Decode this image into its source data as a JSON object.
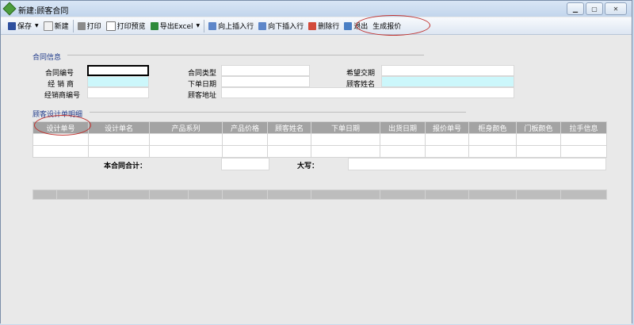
{
  "window": {
    "title": "新建:顾客合同"
  },
  "toolbar": {
    "save": "保存",
    "new": "新建",
    "print": "打印",
    "print_preview": "打印预览",
    "export_excel": "导出Excel",
    "insert_above": "向上插入行",
    "insert_below": "向下插入行",
    "delete_row": "删除行",
    "exit": "退出",
    "generate_quote": "生成报价"
  },
  "contract_info": {
    "section_title": "合同信息",
    "contract_no": {
      "label": "合同编号",
      "value": ""
    },
    "dealer": {
      "label": "经 销 商",
      "value": ""
    },
    "dealer_no": {
      "label": "经销商编号",
      "value": ""
    },
    "contract_type": {
      "label": "合同类型",
      "value": ""
    },
    "order_date": {
      "label": "下单日期",
      "value": ""
    },
    "customer_address": {
      "label": "顾客地址",
      "value": ""
    },
    "expected_delivery": {
      "label": "希望交期",
      "value": ""
    },
    "customer_name": {
      "label": "顾客姓名",
      "value": ""
    }
  },
  "design_details": {
    "section_title": "顾客设计单明细",
    "columns": [
      "设计单号",
      "设计单名",
      "产品系列",
      "产品价格",
      "顾客姓名",
      "下单日期",
      "出货日期",
      "报价单号",
      "柜身颜色",
      "门板颜色",
      "拉手信息"
    ],
    "rows": [
      [
        "",
        "",
        "",
        "",
        "",
        "",
        "",
        "",
        "",
        "",
        ""
      ],
      [
        "",
        "",
        "",
        "",
        "",
        "",
        "",
        "",
        "",
        "",
        ""
      ]
    ],
    "total_label": "本合同合计：",
    "total_value": "",
    "capital_label": "大写：",
    "capital_value": ""
  },
  "colors": {
    "header_bg": "#a3a3a3",
    "cyan_field": "#ccf7fb",
    "section_title": "#1f3a8a",
    "annotation": "#c0312e"
  }
}
